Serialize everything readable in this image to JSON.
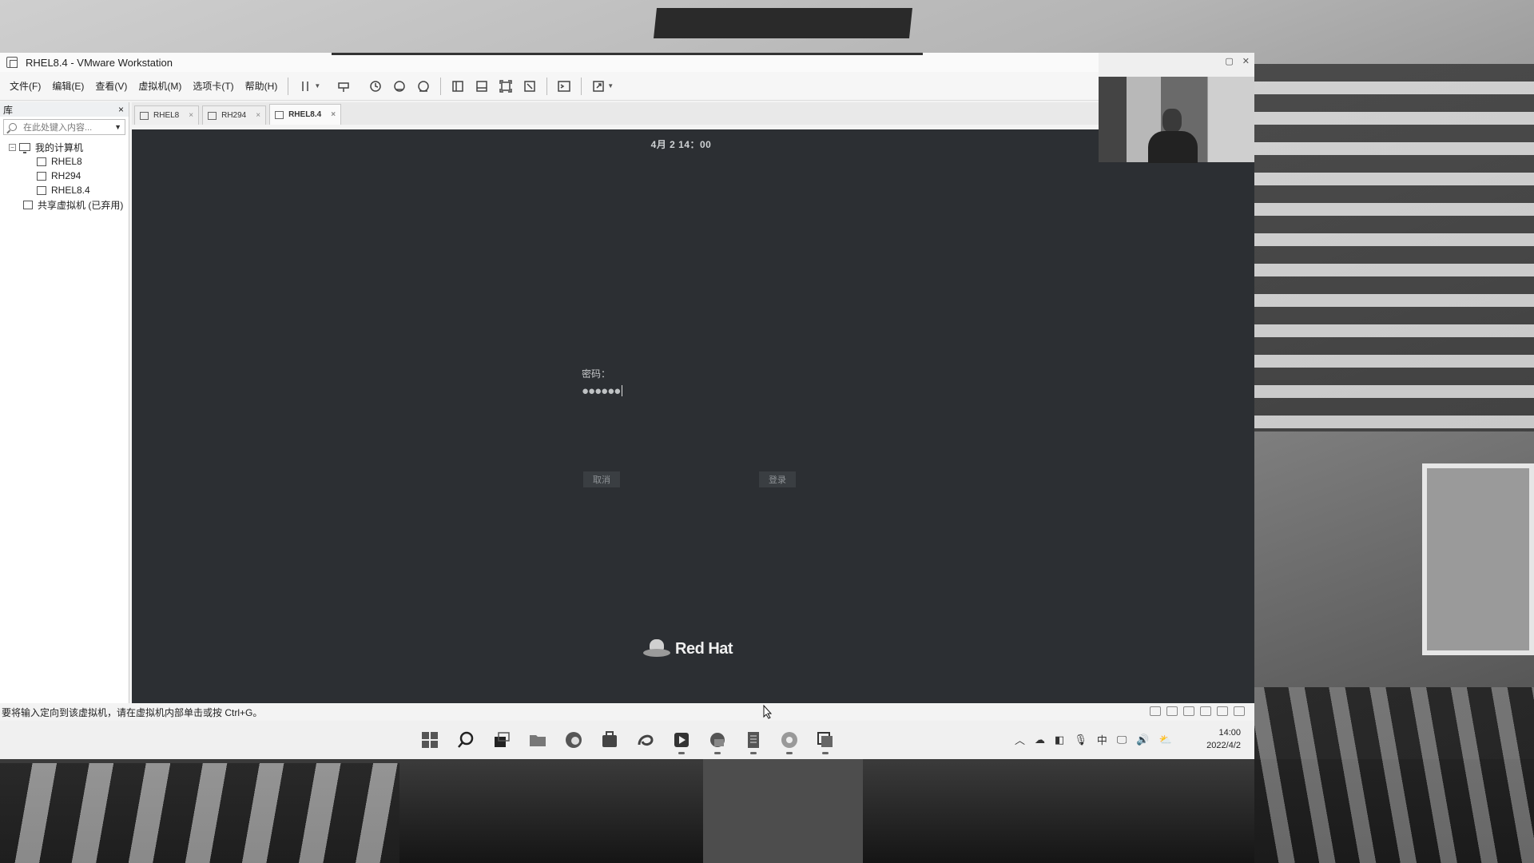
{
  "window": {
    "title": "RHEL8.4 - VMware Workstation"
  },
  "menubar": {
    "items": [
      "文件(F)",
      "编辑(E)",
      "查看(V)",
      "虚拟机(M)",
      "选项卡(T)",
      "帮助(H)"
    ]
  },
  "library": {
    "title": "库",
    "close": "×",
    "search_placeholder": "在此处键入内容...",
    "tree": {
      "root": "我的计算机",
      "vms": [
        "RHEL8",
        "RH294",
        "RHEL8.4"
      ],
      "shared": "共享虚拟机 (已弃用)"
    }
  },
  "tabs": [
    {
      "label": "RHEL8",
      "active": false
    },
    {
      "label": "RH294",
      "active": false
    },
    {
      "label": "RHEL8.4",
      "active": true
    }
  ],
  "console": {
    "clock": "4月 2 14：00",
    "password_label": "密码：",
    "password_mask": "●●●●●●",
    "cancel_label": "取消",
    "login_label": "登录",
    "brand": "Red Hat"
  },
  "statusbar": {
    "message": "要将输入定向到该虚拟机，请在虚拟机内部单击或按 Ctrl+G。"
  },
  "taskbar": {
    "apps": [
      "start-icon",
      "search-icon",
      "task-view-icon",
      "file-explorer-icon",
      "edge-icon",
      "store-icon",
      "app-icon",
      "media-icon",
      "app-icon",
      "notepad-icon",
      "browser-icon",
      "vmware-icon"
    ],
    "tray_ime": "中",
    "time": "14:00",
    "date": "2022/4/2"
  }
}
